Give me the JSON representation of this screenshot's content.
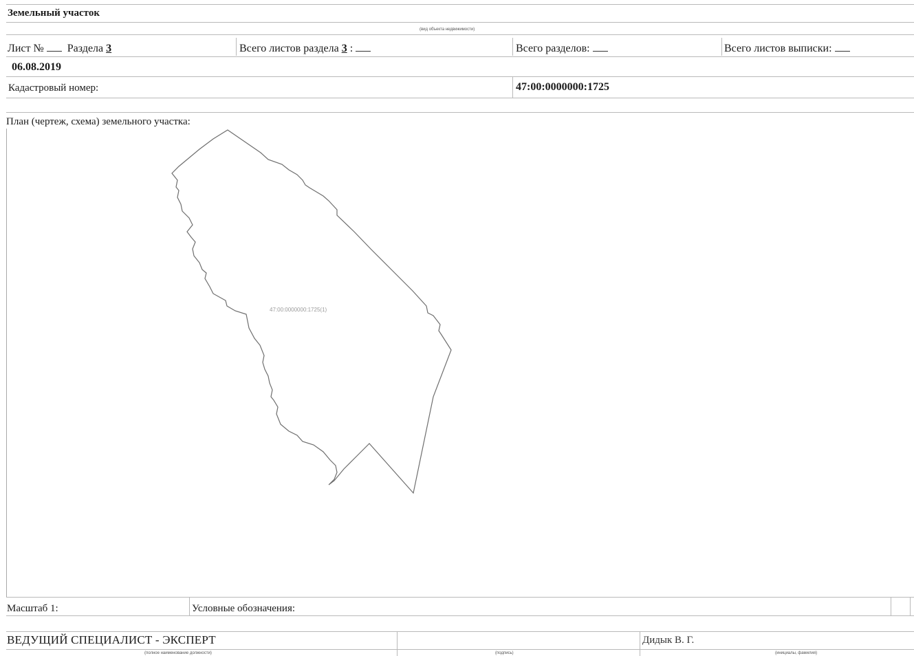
{
  "header": {
    "object_type": "Земельный участок",
    "object_type_caption": "(вид объекта недвижимости)"
  },
  "sheet_row": {
    "sheet_label": "Лист №",
    "section_label": "Раздела",
    "section_number": "3",
    "total_sheets_section_label": "Всего листов раздела",
    "total_sheets_section_value": "3",
    "total_sections_label": "Всего разделов:",
    "total_extract_sheets_label": "Всего листов выписки:"
  },
  "date": "06.08.2019",
  "cadastral": {
    "label": "Кадастровый номер:",
    "value": "47:00:0000000:1725"
  },
  "plan": {
    "title": "План (чертеж, схема) земельного участка:",
    "parcel_label": "47:00:0000000:1725(1)"
  },
  "footer": {
    "scale_label": "Масштаб 1:",
    "legend_label": "Условные обозначения:"
  },
  "signature": {
    "position": "ВЕДУЩИЙ СПЕЦИАЛИСТ - ЭКСПЕРТ",
    "name": "Дидык В. Г.",
    "position_caption": "(полное наименование должности)",
    "signature_caption": "(подпись)",
    "initials_caption": "(инициалы, фамилия)"
  }
}
